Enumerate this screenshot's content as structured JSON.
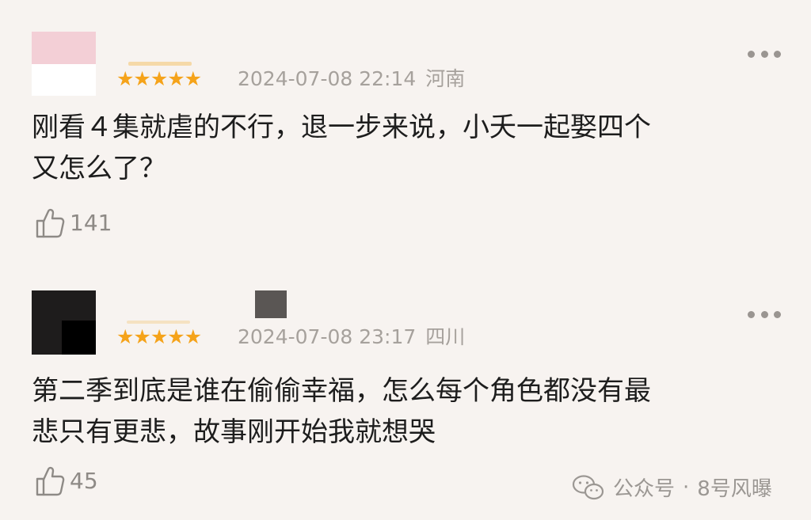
{
  "comments": [
    {
      "rating": "★★★★★",
      "datetime": "2024-07-08 22:14",
      "location": "河南",
      "lines": [
        "刚看４集就虐的不行，退一步来说，小夭一起娶四个",
        "又怎么了？"
      ],
      "likes": "141"
    },
    {
      "rating": "★★★★★",
      "datetime": "2024-07-08 23:17",
      "location": "四川",
      "lines": [
        "第二季到底是谁在偷偷幸福，怎么每个角色都没有最",
        "悲只有更悲，故事刚开始我就想哭"
      ],
      "likes": "45"
    }
  ],
  "watermark": {
    "source": "公众号",
    "separator": "·",
    "account": "8号风曝"
  },
  "colors": {
    "background": "#f7f3f0",
    "star": "#f5a31a",
    "meta": "#a6a19c"
  },
  "icons": {
    "like": "thumbs-up-icon",
    "more": "more-dots-icon",
    "watermark": "wechat-icon"
  }
}
